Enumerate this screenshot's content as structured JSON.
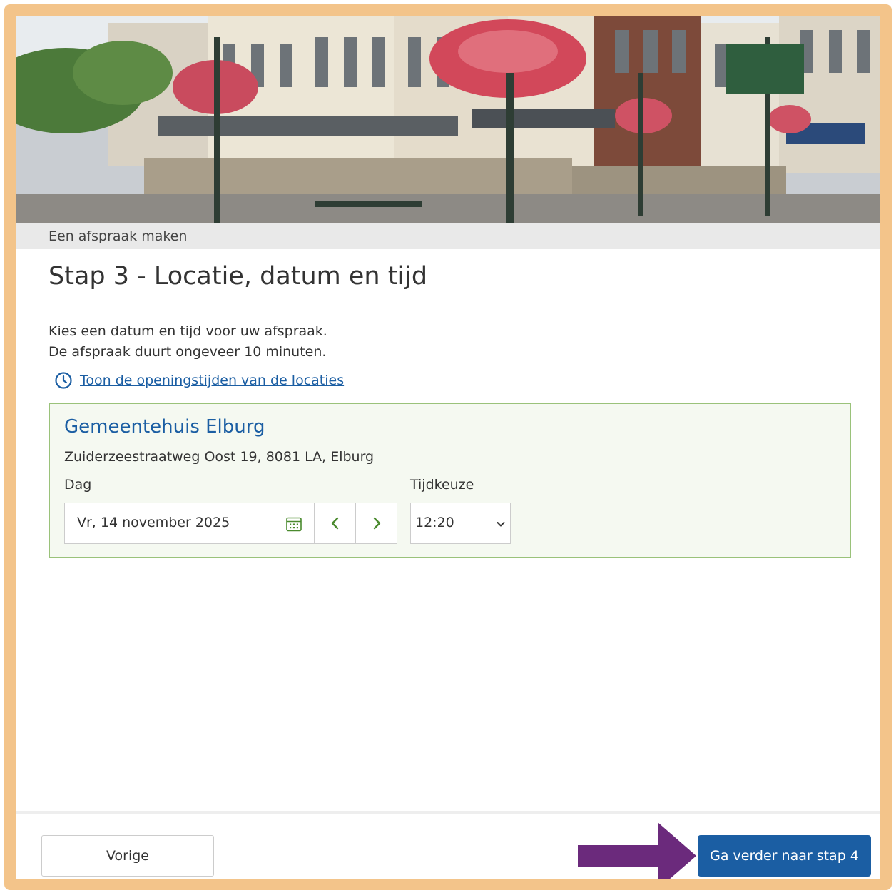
{
  "breadcrumb": "Een afspraak maken",
  "page_title": "Stap 3 - Locatie, datum en tijd",
  "intro": {
    "line1": "Kies een datum en tijd voor uw afspraak.",
    "line2": "De afspraak duurt ongeveer 10 minuten."
  },
  "hours_link": "Toon de openingstijden van de locaties",
  "location": {
    "name": "Gemeentehuis Elburg",
    "address": "Zuiderzeestraatweg Oost 19, 8081 LA, Elburg",
    "day_label": "Dag",
    "day_value": "Vr, 14 november 2025",
    "time_label": "Tijdkeuze",
    "time_value": "12:20"
  },
  "footer": {
    "prev_label": "Vorige",
    "next_label": "Ga verder naar stap 4"
  },
  "icons": {
    "hours": "clock-icon",
    "calendar": "calendar-icon",
    "prev_day": "chevron-left-icon",
    "next_day": "chevron-right-icon",
    "select": "chevron-down-icon",
    "annotation": "arrow-icon"
  },
  "colors": {
    "frame": "#f3c48a",
    "primary": "#1b5ea3",
    "card_border": "#9ac27a",
    "card_bg": "#f5f9f1",
    "chevron": "#4a8a2e",
    "annotation_arrow": "#6b2a7c"
  }
}
